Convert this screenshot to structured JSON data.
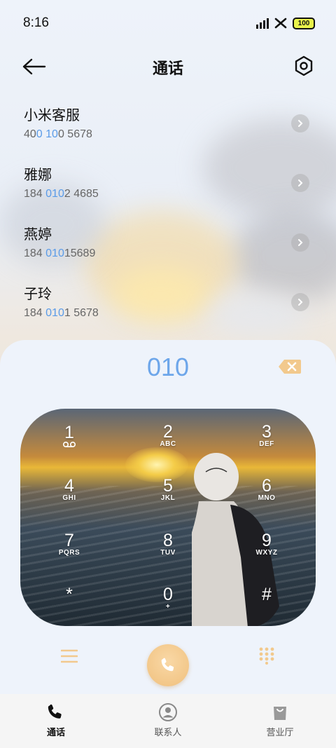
{
  "status": {
    "time": "8:16",
    "battery": "100"
  },
  "header": {
    "title": "通话"
  },
  "contacts": [
    {
      "name": "小米客服",
      "num_pre": "400 ",
      "num_hl1": "0",
      "num_mid": " 10",
      "num_hl2": "0",
      "num_post": " 5678",
      "num_a": "40",
      "hl_a": "0",
      "num_b": " ",
      "hl_b": "10",
      "num_c": "0 5678"
    },
    {
      "name": "雅娜",
      "num_a": "184 ",
      "hl_a": "010",
      "num_b": "",
      "hl_b": "",
      "num_c": "2 4685"
    },
    {
      "name": "燕婷",
      "num_a": "184 ",
      "hl_a": "010",
      "num_b": "",
      "hl_b": "",
      "num_c": "15689"
    },
    {
      "name": "子玲",
      "num_a": "184 ",
      "hl_a": "010",
      "num_b": "",
      "hl_b": "",
      "num_c": "1 5678"
    }
  ],
  "dialer": {
    "input": "010",
    "keys": [
      {
        "digit": "1",
        "letters": "oo"
      },
      {
        "digit": "2",
        "letters": "ABC"
      },
      {
        "digit": "3",
        "letters": "DEF"
      },
      {
        "digit": "4",
        "letters": "GHI"
      },
      {
        "digit": "5",
        "letters": "JKL"
      },
      {
        "digit": "6",
        "letters": "MNO"
      },
      {
        "digit": "7",
        "letters": "PQRS"
      },
      {
        "digit": "8",
        "letters": "TUV"
      },
      {
        "digit": "9",
        "letters": "WXYZ"
      },
      {
        "digit": "*",
        "letters": ""
      },
      {
        "digit": "0",
        "letters": "+"
      },
      {
        "digit": "#",
        "letters": ""
      }
    ]
  },
  "nav": {
    "calls": "通话",
    "contacts": "联系人",
    "store": "营业厅"
  },
  "icons": [
    "back-arrow-icon",
    "settings-icon",
    "chevron-right-icon",
    "backspace-icon",
    "menu-icon",
    "phone-icon",
    "dialpad-icon",
    "contacts-icon",
    "store-bag-icon",
    "voicemail-icon"
  ],
  "colors": {
    "highlight": "#5a9be8",
    "dialed": "#6da6ea",
    "accent": "#f0c07d"
  }
}
